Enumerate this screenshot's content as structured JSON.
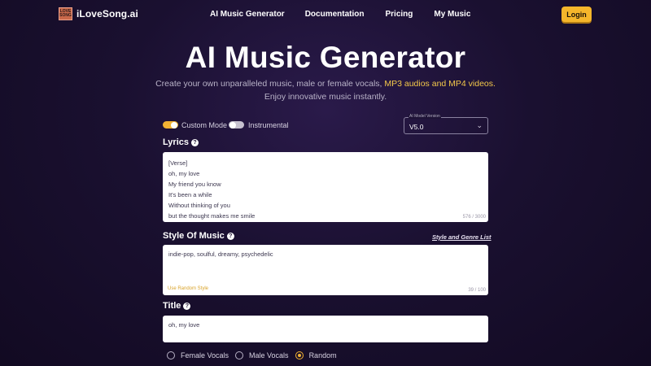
{
  "nav": {
    "brand": "iLoveSong.ai",
    "logo_text": "LOVE SONG",
    "links": [
      "AI Music Generator",
      "Documentation",
      "Pricing",
      "My Music"
    ],
    "login": "Login"
  },
  "hero": {
    "title": "AI Music Generator",
    "subtitle_pre": "Create your own unparalleled music, male or female vocals, ",
    "subtitle_hl": "MP3 audios and MP4 videos.",
    "subtitle2": "Enjoy innovative music instantly."
  },
  "options": {
    "custom_mode": "Custom Mode",
    "instrumental": "Instrumental",
    "custom_mode_on": true,
    "instrumental_on": false,
    "model_legend": "AI Model Version",
    "model_value": "V5.0"
  },
  "lyrics": {
    "label": "Lyrics",
    "lines": [
      "[Verse]",
      "oh, my love",
      "My friend you know",
      "It's been a while",
      "Without thinking of you",
      "but the thought makes me smile"
    ],
    "counter": "576 / 3000"
  },
  "style": {
    "label": "Style Of Music",
    "list_link": "Style and Genre List",
    "value": "indie-pop, soulful, dreamy, psychedelic",
    "random": "Use Random Style",
    "counter": "39 / 100"
  },
  "title_field": {
    "label": "Title",
    "value": "oh, my love"
  },
  "vocals": {
    "options": [
      "Female Vocals",
      "Male Vocals",
      "Random"
    ],
    "selected": "Random"
  },
  "colors": {
    "accent": "#f2b233",
    "background": "#1a1030"
  }
}
